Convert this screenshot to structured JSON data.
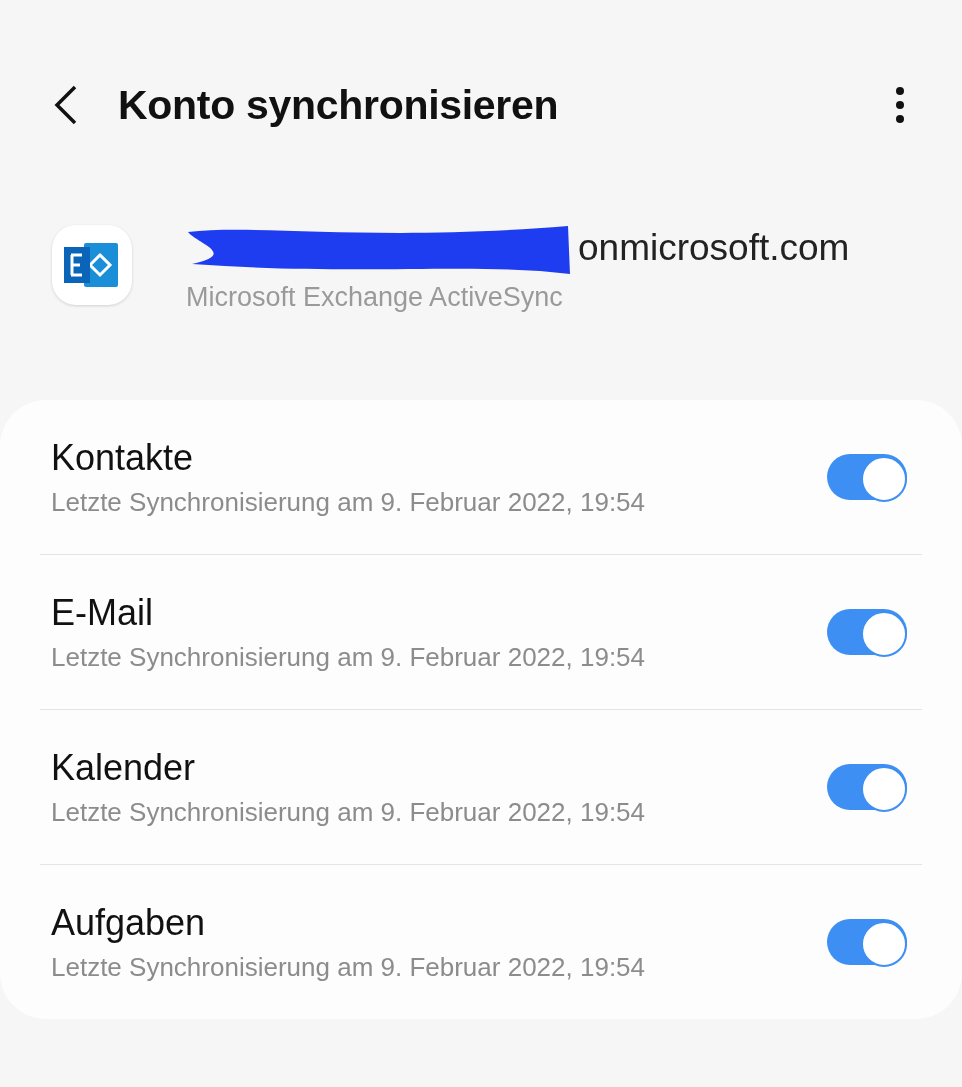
{
  "header": {
    "title": "Konto synchronisieren"
  },
  "account": {
    "email": "onmicrosoft.com",
    "type": "Microsoft Exchange ActiveSync"
  },
  "sync_items": [
    {
      "name": "Kontakte",
      "last_sync": "Letzte Synchronisierung am 9. Februar 2022, 19:54",
      "on": true
    },
    {
      "name": "E-Mail",
      "last_sync": "Letzte Synchronisierung am 9. Februar 2022, 19:54",
      "on": true
    },
    {
      "name": "Kalender",
      "last_sync": "Letzte Synchronisierung am 9. Februar 2022, 19:54",
      "on": true
    },
    {
      "name": "Aufgaben",
      "last_sync": "Letzte Synchronisierung am 9. Februar 2022, 19:54",
      "on": true
    }
  ]
}
